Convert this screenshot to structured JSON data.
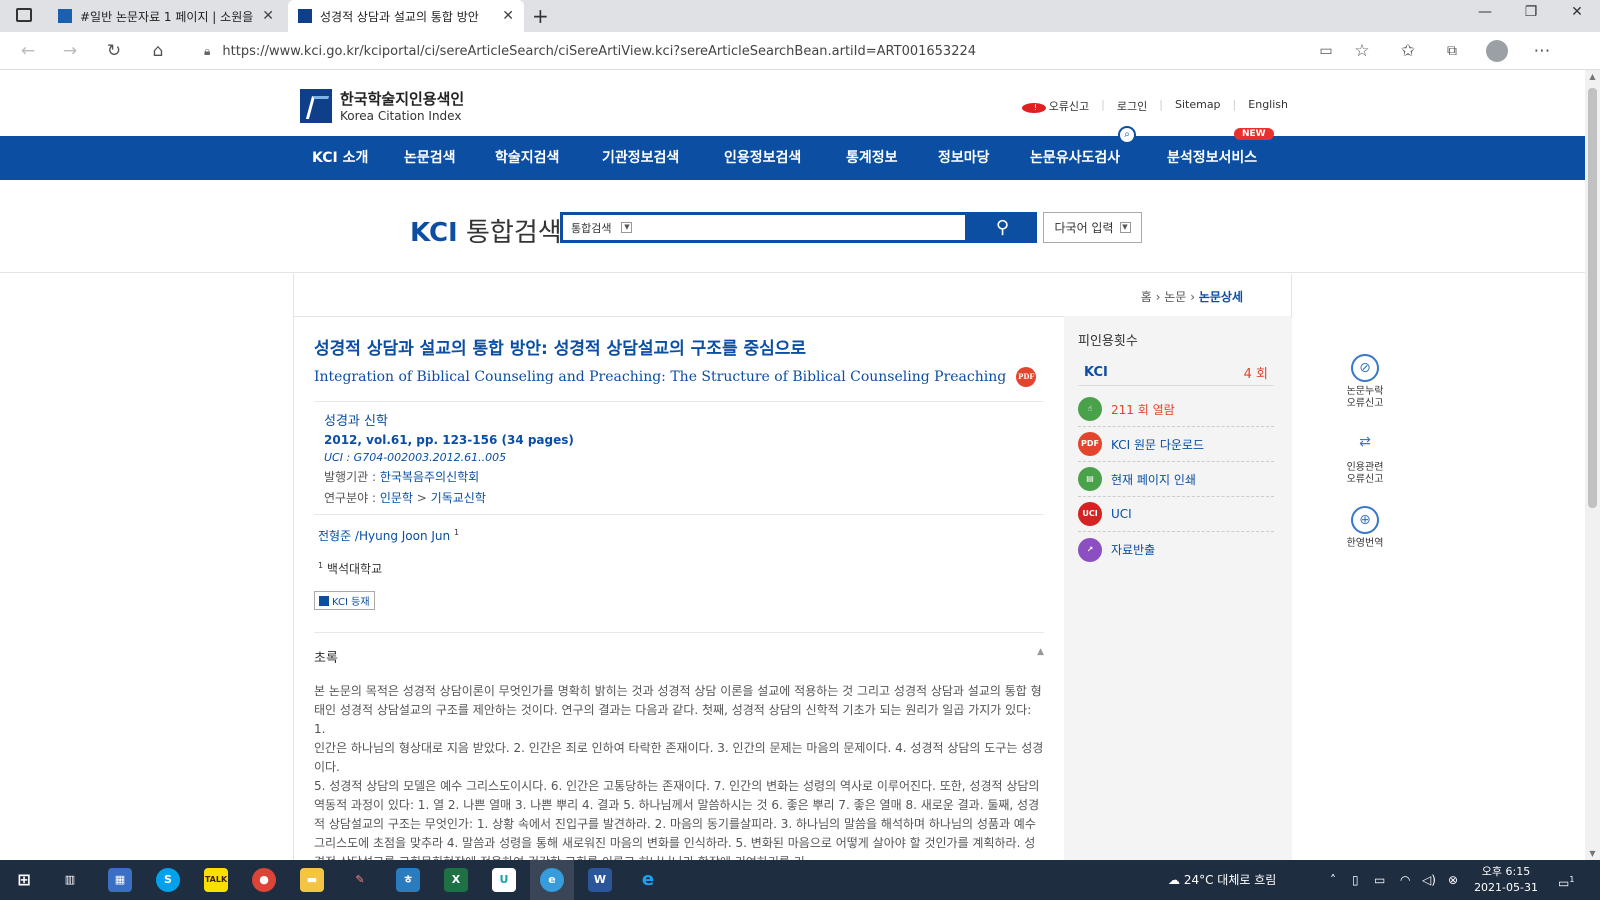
{
  "browser": {
    "tabs": [
      {
        "title": "#일반 논문자료 1 페이지 | 소원을",
        "active": false
      },
      {
        "title": "성경적 상담과 설교의 통합 방안",
        "active": true
      }
    ],
    "new_tab": "+",
    "url": "https://www.kci.go.kr/kciportal/ci/sereArticleSearch/ciSereArtiView.kci?sereArticleSearchBean.artiId=ART001653224",
    "window_controls": {
      "minimize": "—",
      "maximize": "❐",
      "close": "✕"
    },
    "nav_icons": [
      "back-icon",
      "forward-icon",
      "refresh-icon",
      "home-icon"
    ]
  },
  "site": {
    "logo_ko": "한국학술지인용색인",
    "logo_en": "Korea Citation Index",
    "util_links": [
      "오류신고",
      "로그인",
      "Sitemap",
      "English"
    ],
    "nav": [
      "KCI 소개",
      "논문검색",
      "학술지검색",
      "기관정보검색",
      "인용정보검색",
      "통계정보",
      "정보마당",
      "논문유사도검사",
      "분석정보서비스"
    ],
    "new_badge": "NEW",
    "search_title_kci": "KCI",
    "search_title_rest": "통합검색",
    "search_scope": "통합검색",
    "search_value": "",
    "lang_input": "다국어 입력"
  },
  "breadcrumb": {
    "home": "홈",
    "sep": "›",
    "level1": "논문",
    "current": "논문상세"
  },
  "article": {
    "title_ko": "성경적 상담과 설교의 통합 방안: 성경적 상담설교의 구조를 중심으로",
    "title_en": "Integration of Biblical Counseling and Preaching: The Structure of Biblical Counseling Preaching",
    "pdf_label": "PDF",
    "journal": "성경과 신학",
    "volume": "2012, vol.61, pp. 123-156 (34 pages)",
    "uci": "UCI : G704-002003.2012.61..005",
    "publisher_label": "발행기관 : ",
    "publisher": "한국복음주의신학회",
    "field_label": "연구분야 : ",
    "field_1": "인문학",
    "field_sep": " > ",
    "field_2": "기독교신학",
    "author": "전형준 /Hyung Joon Jun",
    "author_sup": "1",
    "affil_sup": "1",
    "affiliation": "백석대학교",
    "kci_badge": "KCI 등재",
    "abstract_label": "초록",
    "abstract": "본 논문의 목적은 성경적 상담이론이 무엇인가를 명확히 밝히는 것과 성경적 상담 이론을 설교에 적용하는 것 그리고 성경적 상담과 설교의 통합 형태인 성경적 상담설교의 구조를 제안하는 것이다. 연구의 결과는 다음과 같다. 첫째, 성경적 상담의 신학적 기초가 되는 원리가 일곱 가지가 있다: 1.\n인간은 하나님의 형상대로 지음 받았다. 2. 인간은 죄로 인하여 타락한 존재이다. 3. 인간의 문제는 마음의 문제이다. 4. 성경적 상담의 도구는 성경이다.\n5. 성경적 상담의 모델은 예수 그리스도이시다. 6. 인간은 고통당하는 존재이다. 7. 인간의 변화는 성령의 역사로 이루어진다. 또한, 성경적 상담의 역동적 과정이 있다: 1. 열 2. 나쁜 열매 3. 나쁜 뿌리 4. 결과 5. 하나님께서 말씀하시는 것 6. 좋은 뿌리 7. 좋은 열매 8. 새로운 결과. 둘째, 성경적 상담설교의 구조는 무엇인가: 1. 상황 속에서 진입구를 발견하라. 2. 마음의 동기를살피라. 3. 하나님의 말씀을 해석하며 하나님의 성품과 예수 그리스도에 초점을 맞추라 4. 말씀과 성령을 통해 새로워진 마음의 변화를 인식하라. 5. 변화된 마음으로 어떻게 살아야 할 것인가를 계획하라. 성경적 상담설교를 교회목회현장에 적용하여 건강한 교회를 이루고 하나님나라 확장에 기여하기를 기"
  },
  "sidebar": {
    "cite_title": "피인용횟수",
    "cite_kci_label": "KCI",
    "cite_kci_value": "4 회",
    "actions": [
      {
        "label": "211 회 열람",
        "icon": "hand-pointer-icon",
        "color": "#49a14a"
      },
      {
        "label": "KCI 원문 다운로드",
        "icon": "pdf-icon",
        "icon_text": "PDF",
        "color": "#e2452c"
      },
      {
        "label": "현재 페이지 인쇄",
        "icon": "printer-icon",
        "color": "#49a14a"
      },
      {
        "label": "UCI",
        "icon": "uci-icon",
        "icon_text": "UCI",
        "color": "#d62222"
      },
      {
        "label": "자료반출",
        "icon": "export-icon",
        "color": "#8b4fc1"
      }
    ]
  },
  "quick_menu": [
    {
      "label_1": "논문누락",
      "label_2": "오류신고",
      "icon": "compass-icon"
    },
    {
      "label_1": "인용관련",
      "label_2": "오류신고",
      "icon": "swap-arrows-icon"
    },
    {
      "label_1": "한영번역",
      "label_2": "",
      "icon": "globe-icon"
    }
  ],
  "taskbar": {
    "weather": "24°C 대체로 흐림",
    "time": "오후 6:15",
    "date": "2021-05-31",
    "notification_count": "1",
    "apps": [
      "windows-start-icon",
      "task-view-icon",
      "store-icon",
      "skype-icon",
      "kakaotalk-icon",
      "chrome-icon",
      "file-explorer-icon",
      "pen-icon",
      "hwp-icon",
      "excel-icon",
      "uplus-icon",
      "edge-icon",
      "word-icon",
      "internet-explorer-icon"
    ]
  }
}
